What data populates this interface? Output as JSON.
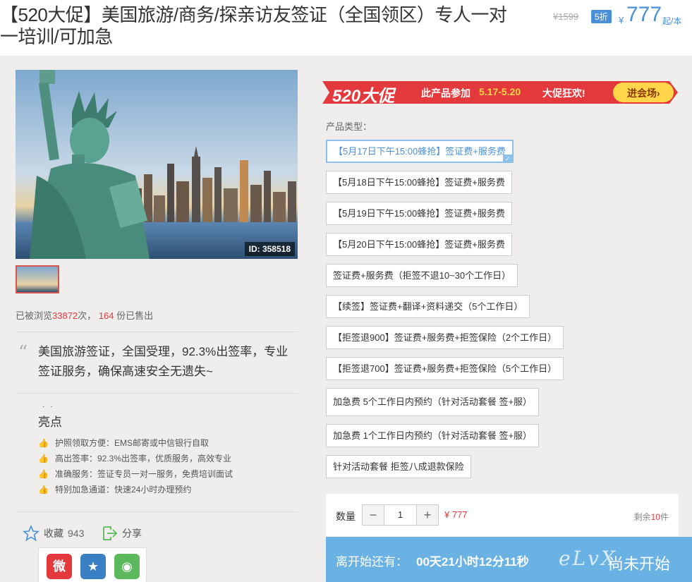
{
  "product": {
    "title": "【520大促】美国旅游/商务/探亲访友签证（全国领区）专人一对一培训/可加急",
    "old_price": "¥1599",
    "discount": "5折",
    "currency": "¥",
    "price": "777",
    "unit": "起/本"
  },
  "gallery": {
    "image_id": "ID: 358518"
  },
  "stats": {
    "prefix": "已被浏览",
    "views": "33872",
    "views_suffix": "次，",
    "sold": "164",
    "sold_suffix": "份已售出"
  },
  "summary": {
    "quote": "美国旅游签证，全国受理，92.3%出签率，专业签证服务，确保高速安全无遗失~"
  },
  "highlights": {
    "title": "亮点",
    "dots": "··",
    "items": [
      "护照领取方便：EMS邮寄或中信银行自取",
      "高出签率：92.3%出签率，优质服务，高效专业",
      "准确服务：签证专员一对一服务，免费培训面试",
      "特别加急通道：快速24小时办理预约"
    ]
  },
  "actions": {
    "favorite_label": "收藏",
    "favorite_count": "943",
    "share_label": "分享"
  },
  "promo": {
    "badge": "520大促",
    "text": "此产品参加",
    "dates": "5.17-5.20",
    "text2": "大促狂欢!",
    "cta": "进会场›"
  },
  "product_type": {
    "label": "产品类型：",
    "options": [
      "【5月17日下午15:00蜂抢】签证费+服务费",
      "【5月18日下午15:00蜂抢】签证费+服务费",
      "【5月19日下午15:00蜂抢】签证费+服务费",
      "【5月20日下午15:00蜂抢】签证费+服务费",
      "签证费+服务费（拒签不退10~30个工作日）",
      "【续签】签证费+翻译+资料递交（5个工作日）",
      "【拒签退900】签证费+服务费+拒签保险（2个工作日）",
      "【拒签退700】签证费+服务费+拒签保险（5个工作日）",
      "加急费 5个工作日内预约（针对活动套餐 签+服）",
      "加急费 1个工作日内预约（针对活动套餐 签+服）",
      "针对活动套餐 拒签八成退款保险"
    ],
    "selected_index": 0
  },
  "quantity": {
    "label": "数量",
    "minus": "−",
    "value": "1",
    "plus": "+",
    "price": "¥ 777",
    "remain_prefix": "剩余",
    "remain_count": "10",
    "remain_suffix": "件"
  },
  "countdown": {
    "label": "离开始还有：",
    "time": "00天21小时12分11秒",
    "status": "尚未开始",
    "watermark": "eLvX"
  },
  "colors": {
    "accent": "#4a90d9",
    "red": "#e4393c",
    "countdown_bg": "#6ab2e3"
  }
}
